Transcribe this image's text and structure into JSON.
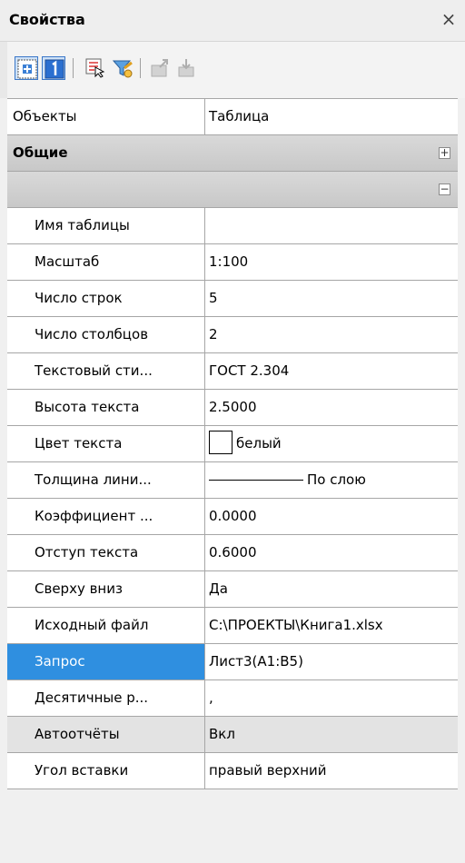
{
  "panel": {
    "title": "Свойства",
    "close_glyph": "×"
  },
  "toolbar": {
    "buttons": [
      {
        "icon": "select-all-icon"
      },
      {
        "icon": "single-select-icon"
      },
      {
        "icon": "pick-objects-icon"
      },
      {
        "icon": "filter-icon"
      },
      {
        "icon": "export-icon"
      },
      {
        "icon": "import-icon"
      }
    ]
  },
  "objects_row": {
    "key": "Объекты",
    "value": "Таблица"
  },
  "categories": {
    "general": {
      "label": "Общие",
      "toggle": "+"
    },
    "table": {
      "label": "",
      "toggle": "−"
    }
  },
  "properties": [
    {
      "key": "Имя таблицы",
      "value": ""
    },
    {
      "key": "Масштаб",
      "value": "1:100"
    },
    {
      "key": "Число строк",
      "value": "5"
    },
    {
      "key": "Число столбцов",
      "value": "2"
    },
    {
      "key": "Текстовый сти...",
      "value": "ГОСТ 2.304"
    },
    {
      "key": "Высота текста",
      "value": "2.5000"
    },
    {
      "key": "Цвет текста",
      "value": "белый"
    },
    {
      "key": "Толщина лини...",
      "value": "По слою"
    },
    {
      "key": "Коэффициент ...",
      "value": "0.0000"
    },
    {
      "key": "Отступ текста",
      "value": "0.6000"
    },
    {
      "key": "Сверху вниз",
      "value": "Да"
    },
    {
      "key": "Исходный файл",
      "value": "C:\\ПРОЕКТЫ\\Книга1.xlsx"
    },
    {
      "key": "Запрос",
      "value": "Лист3(A1:B5)"
    },
    {
      "key": "Десятичные р...",
      "value": ","
    },
    {
      "key": "Автоотчёты",
      "value": "Вкл"
    },
    {
      "key": "Угол вставки",
      "value": "правый верхний"
    }
  ],
  "colors": {
    "selected_row": "#2f8fe0",
    "highlight_row": "#e3e3e3",
    "text_color_swatch": "#ffffff"
  }
}
